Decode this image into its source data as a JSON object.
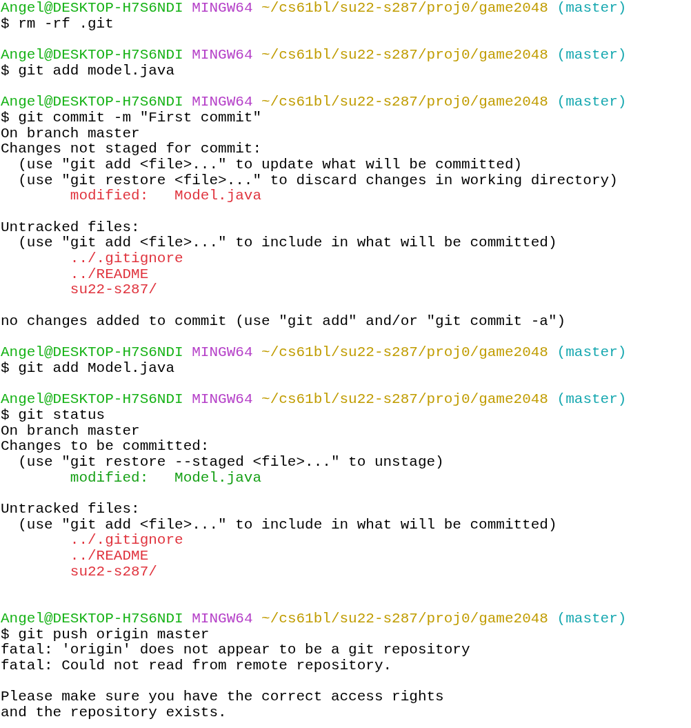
{
  "terminal": {
    "lines": [
      {
        "kind": "prompt",
        "user": "Angel@DESKTOP-H7S6NDI",
        "shell": "MINGW64",
        "path": "~/cs61bl/su22-s287/proj0/game2048",
        "branch": "(master)"
      },
      {
        "kind": "command",
        "text": "$ rm -rf .git"
      },
      {
        "kind": "blank"
      },
      {
        "kind": "prompt",
        "user": "Angel@DESKTOP-H7S6NDI",
        "shell": "MINGW64",
        "path": "~/cs61bl/su22-s287/proj0/game2048",
        "branch": "(master)"
      },
      {
        "kind": "command",
        "text": "$ git add model.java"
      },
      {
        "kind": "blank"
      },
      {
        "kind": "prompt",
        "user": "Angel@DESKTOP-H7S6NDI",
        "shell": "MINGW64",
        "path": "~/cs61bl/su22-s287/proj0/game2048",
        "branch": "(master)"
      },
      {
        "kind": "command",
        "text": "$ git commit -m \"First commit\""
      },
      {
        "kind": "output",
        "text": "On branch master"
      },
      {
        "kind": "output",
        "text": "Changes not staged for commit:"
      },
      {
        "kind": "output",
        "text": "  (use \"git add <file>...\" to update what will be committed)"
      },
      {
        "kind": "output",
        "text": "  (use \"git restore <file>...\" to discard changes in working directory)"
      },
      {
        "kind": "output",
        "color": "#e0343e",
        "text": "        modified:   Model.java"
      },
      {
        "kind": "blank"
      },
      {
        "kind": "output",
        "text": "Untracked files:"
      },
      {
        "kind": "output",
        "text": "  (use \"git add <file>...\" to include in what will be committed)"
      },
      {
        "kind": "output",
        "color": "#e0343e",
        "text": "        ../.gitignore"
      },
      {
        "kind": "output",
        "color": "#e0343e",
        "text": "        ../README"
      },
      {
        "kind": "output",
        "color": "#e0343e",
        "text": "        su22-s287/"
      },
      {
        "kind": "blank"
      },
      {
        "kind": "output",
        "text": "no changes added to commit (use \"git add\" and/or \"git commit -a\")"
      },
      {
        "kind": "blank"
      },
      {
        "kind": "prompt",
        "user": "Angel@DESKTOP-H7S6NDI",
        "shell": "MINGW64",
        "path": "~/cs61bl/su22-s287/proj0/game2048",
        "branch": "(master)"
      },
      {
        "kind": "command",
        "text": "$ git add Model.java"
      },
      {
        "kind": "blank"
      },
      {
        "kind": "prompt",
        "user": "Angel@DESKTOP-H7S6NDI",
        "shell": "MINGW64",
        "path": "~/cs61bl/su22-s287/proj0/game2048",
        "branch": "(master)"
      },
      {
        "kind": "command",
        "text": "$ git status"
      },
      {
        "kind": "output",
        "text": "On branch master"
      },
      {
        "kind": "output",
        "text": "Changes to be committed:"
      },
      {
        "kind": "output",
        "text": "  (use \"git restore --staged <file>...\" to unstage)"
      },
      {
        "kind": "output",
        "color": "#16a016",
        "text": "        modified:   Model.java"
      },
      {
        "kind": "blank"
      },
      {
        "kind": "output",
        "text": "Untracked files:"
      },
      {
        "kind": "output",
        "text": "  (use \"git add <file>...\" to include in what will be committed)"
      },
      {
        "kind": "output",
        "color": "#e0343e",
        "text": "        ../.gitignore"
      },
      {
        "kind": "output",
        "color": "#e0343e",
        "text": "        ../README"
      },
      {
        "kind": "output",
        "color": "#e0343e",
        "text": "        su22-s287/"
      },
      {
        "kind": "blank"
      },
      {
        "kind": "blank"
      },
      {
        "kind": "prompt",
        "user": "Angel@DESKTOP-H7S6NDI",
        "shell": "MINGW64",
        "path": "~/cs61bl/su22-s287/proj0/game2048",
        "branch": "(master)"
      },
      {
        "kind": "command",
        "text": "$ git push origin master"
      },
      {
        "kind": "output",
        "text": "fatal: 'origin' does not appear to be a git repository"
      },
      {
        "kind": "output",
        "text": "fatal: Could not read from remote repository."
      },
      {
        "kind": "blank"
      },
      {
        "kind": "output",
        "text": "Please make sure you have the correct access rights"
      },
      {
        "kind": "output",
        "text": "and the repository exists."
      }
    ]
  }
}
